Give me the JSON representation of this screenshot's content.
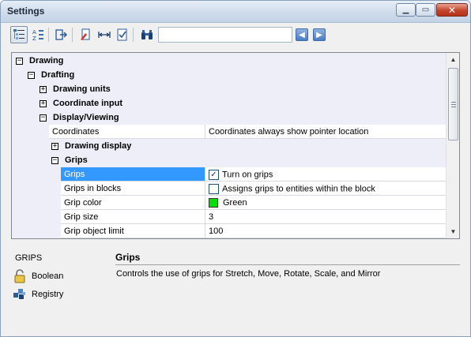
{
  "window": {
    "title": "Settings",
    "min_glyph": "▁",
    "max_glyph": "▭",
    "close_glyph": "✕"
  },
  "toolbar": {
    "search_value": "",
    "nav_prev": "◀",
    "nav_next": "▶"
  },
  "tree": {
    "nodes": [
      {
        "label": "Drawing",
        "expander": "−"
      },
      {
        "label": "Drafting",
        "expander": "−"
      },
      {
        "label": "Drawing units",
        "expander": "+"
      },
      {
        "label": "Coordinate input",
        "expander": "+"
      },
      {
        "label": "Display/Viewing",
        "expander": "−"
      },
      {
        "label": "Drawing display",
        "expander": "+"
      },
      {
        "label": "Grips",
        "expander": "−"
      }
    ],
    "coordinates": {
      "name": "Coordinates",
      "value": "Coordinates always show pointer location"
    },
    "grips": [
      {
        "name": "Grips",
        "value": "Turn on grips",
        "checked": "✓"
      },
      {
        "name": "Grips in blocks",
        "value": "Assigns grips to entities within the block",
        "checked": ""
      },
      {
        "name": "Grip color",
        "value": "Green",
        "swatch": "#00e000"
      },
      {
        "name": "Grip size",
        "value": "3"
      },
      {
        "name": "Grip object limit",
        "value": "100"
      }
    ]
  },
  "scrollbar": {
    "up": "▲",
    "down": "▼"
  },
  "info": {
    "variable": "GRIPS",
    "type_label": "Boolean",
    "storage_label": "Registry",
    "heading": "Grips",
    "description": "Controls the use of grips for Stretch, Move, Rotate, Scale, and Mirror"
  },
  "colors": {
    "selection": "#3399ff",
    "tree_bg": "#edeef8"
  }
}
